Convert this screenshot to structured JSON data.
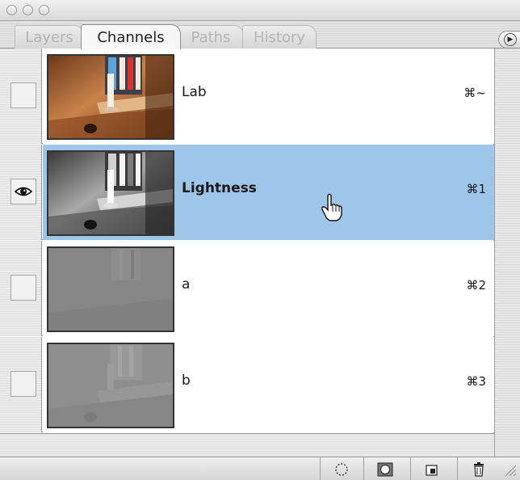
{
  "window": {
    "controls": [
      "close-button",
      "minimize-button",
      "zoom-button"
    ]
  },
  "tabs": [
    {
      "label": "Layers",
      "active": false
    },
    {
      "label": "Channels",
      "active": true
    },
    {
      "label": "Paths",
      "active": false
    },
    {
      "label": "History",
      "active": false
    }
  ],
  "panel_menu": {
    "icon": "triangle-right-icon",
    "glyph": "▶"
  },
  "channels": [
    {
      "name": "Lab",
      "shortcut": "⌘~",
      "visible": false,
      "selected": false,
      "thumbnail": "color-window-candle"
    },
    {
      "name": "Lightness",
      "shortcut": "⌘1",
      "visible": true,
      "selected": true,
      "thumbnail": "grayscale-window-candle"
    },
    {
      "name": "a",
      "shortcut": "⌘2",
      "visible": false,
      "selected": false,
      "thumbnail": "flat-gray-a-channel"
    },
    {
      "name": "b",
      "shortcut": "⌘3",
      "visible": false,
      "selected": false,
      "thumbnail": "flat-gray-b-channel"
    }
  ],
  "icons": {
    "eye": "eye-icon",
    "cursor": "hand-pointer-icon"
  },
  "colors": {
    "selection": "#9ec6e9",
    "panel_bg": "#ffffff",
    "gutter": "#e4e4e4"
  },
  "toolbar": {
    "buttons": [
      {
        "name": "load-channel-as-selection-button",
        "icon": "dotted-circle-icon"
      },
      {
        "name": "save-selection-as-channel-button",
        "icon": "mask-circle-icon"
      },
      {
        "name": "create-new-channel-button",
        "icon": "new-page-icon"
      },
      {
        "name": "delete-channel-button",
        "icon": "trash-icon"
      }
    ]
  }
}
